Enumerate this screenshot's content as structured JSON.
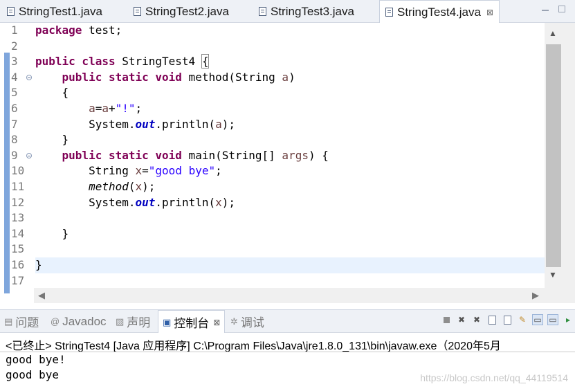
{
  "editor_tabs": [
    {
      "label": "StringTest1.java",
      "active": false
    },
    {
      "label": "StringTest2.java",
      "active": false
    },
    {
      "label": "StringTest3.java",
      "active": false
    },
    {
      "label": "StringTest4.java",
      "active": true
    }
  ],
  "tab_close_glyph": "⊠",
  "line_numbers": [
    "1",
    "2",
    "3",
    "4",
    "5",
    "6",
    "7",
    "8",
    "9",
    "10",
    "11",
    "12",
    "13",
    "14",
    "15",
    "16",
    "17"
  ],
  "code": {
    "l1_kw": "package",
    "l1_rest": " test;",
    "l3_kw": "public class",
    "l3_name": " StringTest4 ",
    "l3_brace": "{",
    "l4_indent": "    ",
    "l4_kw": "public static void",
    "l4_rest": " method(String ",
    "l4_param": "a",
    "l4_close": ")",
    "l5": "    {",
    "l6_indent": "        ",
    "l6_var1": "a",
    "l6_eq": "=",
    "l6_var2": "a",
    "l6_plus": "+",
    "l6_str": "\"!\"",
    "l6_end": ";",
    "l7_a": "        System.",
    "l7_out": "out",
    "l7_b": ".println(",
    "l7_var": "a",
    "l7_c": ");",
    "l8": "    }",
    "l9_indent": "    ",
    "l9_kw": "public static void",
    "l9_rest": " main(String[] ",
    "l9_param": "args",
    "l9_close": ") {",
    "l10_a": "        String ",
    "l10_var": "x",
    "l10_eq": "=",
    "l10_str": "\"good bye\"",
    "l10_end": ";",
    "l11_indent": "        ",
    "l11_method": "method",
    "l11_open": "(",
    "l11_var": "x",
    "l11_end": ");",
    "l12_a": "        System.",
    "l12_out": "out",
    "l12_b": ".println(",
    "l12_var": "x",
    "l12_c": ");",
    "l14": "    }",
    "l16": "}"
  },
  "bottom_tabs": [
    {
      "label": "问题",
      "icon": "problems-icon",
      "active": false
    },
    {
      "label": "Javadoc",
      "icon": "javadoc-icon",
      "active": false
    },
    {
      "label": "声明",
      "icon": "declaration-icon",
      "active": false
    },
    {
      "label": "控制台",
      "icon": "console-icon",
      "active": true
    },
    {
      "label": "调试",
      "icon": "debug-icon",
      "active": false
    }
  ],
  "console": {
    "header": "<已终止> StringTest4 [Java 应用程序] C:\\Program Files\\Java\\jre1.8.0_131\\bin\\javaw.exe（2020年5月",
    "output": [
      "good bye!",
      "good bye"
    ]
  },
  "watermark": "https://blog.csdn.net/qq_44119514",
  "colors": {
    "keyword": "#7f0055",
    "string": "#2a00ff",
    "field": "#0000c0",
    "current_line": "#e8f2fe",
    "change_bar": "#7fa6dc"
  }
}
